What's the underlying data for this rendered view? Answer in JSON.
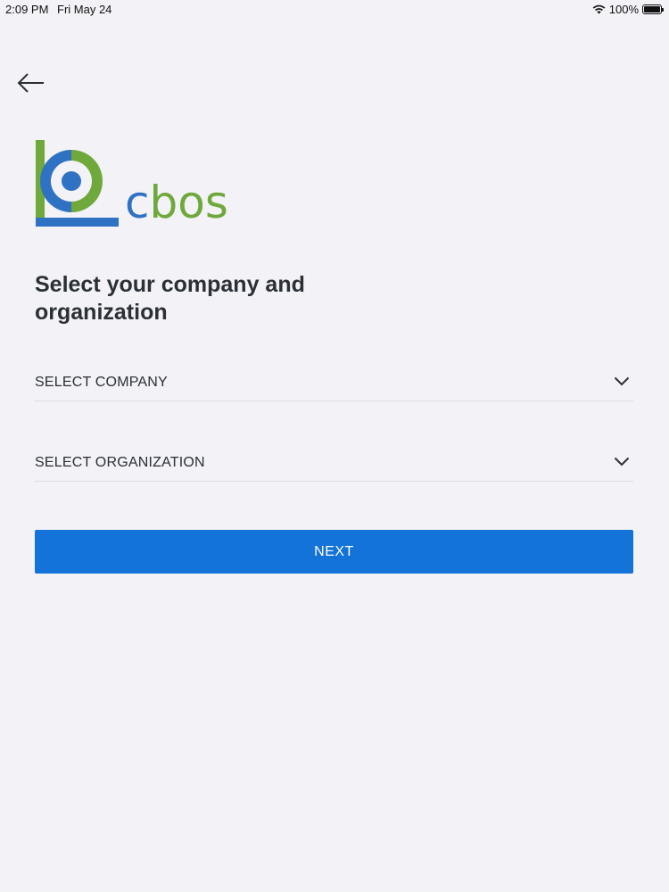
{
  "status_bar": {
    "time": "2:09 PM",
    "date": "Fri May 24",
    "battery": "100%",
    "icons": [
      "wifi-icon",
      "battery-icon"
    ]
  },
  "header": {
    "back_icon": "arrow-left-icon"
  },
  "logo": {
    "wordmark_c": "c",
    "wordmark_bos": "bos",
    "colors": {
      "blue": "#2f72c4",
      "green": "#6fa83b"
    }
  },
  "main": {
    "title": "Select your company and organization",
    "company_select": {
      "placeholder": "SELECT COMPANY",
      "icon": "chevron-down-icon"
    },
    "organization_select": {
      "placeholder": "SELECT ORGANIZATION",
      "icon": "chevron-down-icon"
    },
    "next_label": "NEXT"
  },
  "colors": {
    "background": "#f2f2f7",
    "accent": "#1473d8",
    "text": "#2b2f36",
    "divider": "#dcdde2"
  }
}
